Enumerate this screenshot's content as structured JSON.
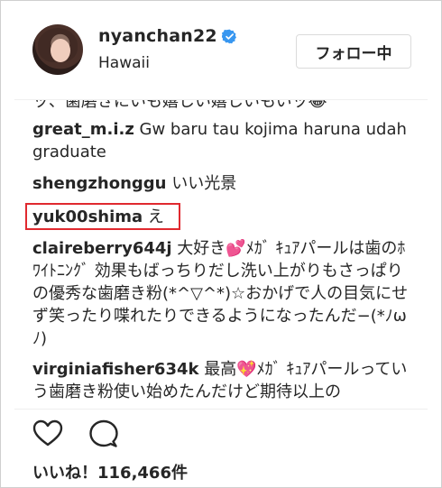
{
  "header": {
    "username": "nyanchan22",
    "location": "Hawaii",
    "follow_label": "フォロー中"
  },
  "comments": {
    "truncated_line": "ッ、歯磨きにいも嬉しい嬉しいもいッ😂",
    "items": [
      {
        "user": "great_m.i.z",
        "text": " Gw baru tau kojima haruna udah graduate"
      },
      {
        "user": "shengzhonggu",
        "text": " いい光景"
      },
      {
        "user": "yuk00shima",
        "text": " え"
      },
      {
        "user": "claireberry644j",
        "text": " 大好き💕ﾒｶﾞ ｷｭｱパールは歯のﾎﾜｲﾄﾆﾝｸﾞ 効果もばっちりだし洗い上がりもさっぱりの優秀な歯磨き粉(*^▽^*)☆おかげで人の目気にせず笑ったり喋れたりできるようになったんだ−(*ﾉωﾉ)"
      },
      {
        "user": "virginiafisher634k",
        "text": " 最高💖ﾒｶﾞ ｷｭｱパールっていう歯磨き粉使い始めたんだけど期待以上の"
      }
    ]
  },
  "actions": {
    "like_icon": "heart-icon",
    "comment_icon": "comment-icon"
  },
  "likes": {
    "label": "いいね！116,466件"
  },
  "colors": {
    "highlight": "#e0292f",
    "verified": "#3897f0",
    "text": "#262626"
  }
}
